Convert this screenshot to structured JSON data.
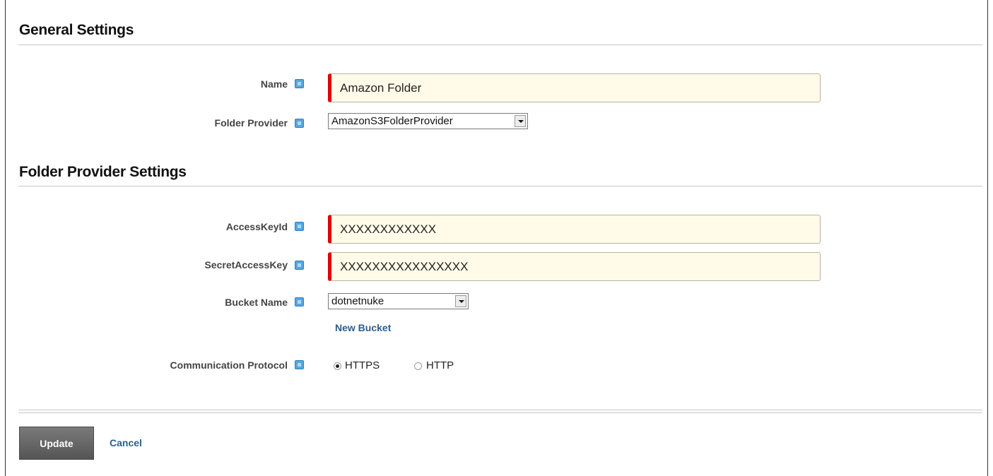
{
  "general": {
    "title": "General Settings",
    "name_label": "Name",
    "name_value": "Amazon Folder",
    "provider_label": "Folder Provider",
    "provider_value": "AmazonS3FolderProvider"
  },
  "provider_settings": {
    "title": "Folder Provider Settings",
    "access_key_label": "AccessKeyId",
    "access_key_value": "XXXXXXXXXXXX",
    "secret_key_label": "SecretAccessKey",
    "secret_key_value": "XXXXXXXXXXXXXXXX",
    "bucket_label": "Bucket Name",
    "bucket_value": "dotnetnuke",
    "new_bucket_link": "New Bucket",
    "protocol_label": "Communication Protocol",
    "protocol_options": [
      {
        "label": "HTTPS",
        "checked": true
      },
      {
        "label": "HTTP",
        "checked": false
      }
    ]
  },
  "actions": {
    "update_label": "Update",
    "cancel_label": "Cancel"
  },
  "icons": {
    "help": "help-icon",
    "dropdown": "chevron-down-icon"
  },
  "colors": {
    "required_marker": "#e00000",
    "input_background": "#fffbe8",
    "help_icon": "#56a7de",
    "link": "#2a5e8c",
    "update_button": "#666666"
  }
}
